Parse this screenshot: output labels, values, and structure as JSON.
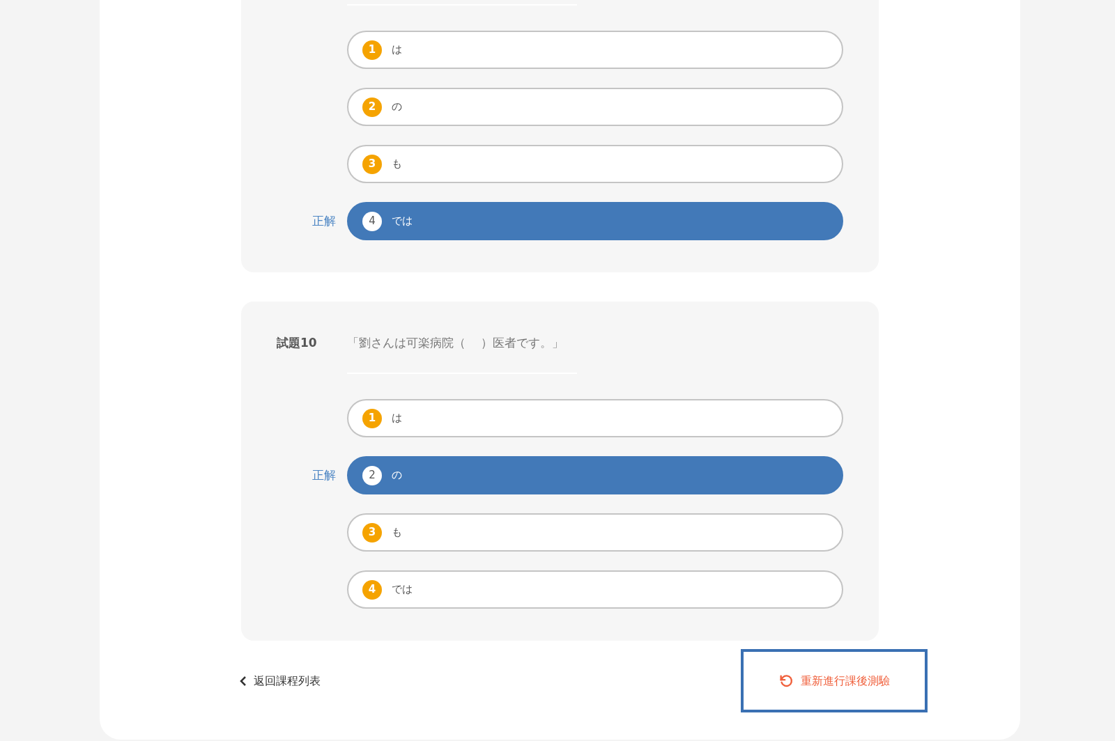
{
  "questions": [
    {
      "options": [
        {
          "number": "1",
          "text": "は",
          "correct": false
        },
        {
          "number": "2",
          "text": "の",
          "correct": false
        },
        {
          "number": "3",
          "text": "も",
          "correct": false
        },
        {
          "number": "4",
          "text": "では",
          "correct": true,
          "correct_label": "正解"
        }
      ]
    },
    {
      "label": "試題10",
      "text": "「劉さんは可楽病院（　 ）医者です。」",
      "options": [
        {
          "number": "1",
          "text": "は",
          "correct": false
        },
        {
          "number": "2",
          "text": "の",
          "correct": true,
          "correct_label": "正解"
        },
        {
          "number": "3",
          "text": "も",
          "correct": false
        },
        {
          "number": "4",
          "text": "では",
          "correct": false
        }
      ]
    }
  ],
  "back_link": "返回課程列表",
  "retry_button": "重新進行課後測驗"
}
